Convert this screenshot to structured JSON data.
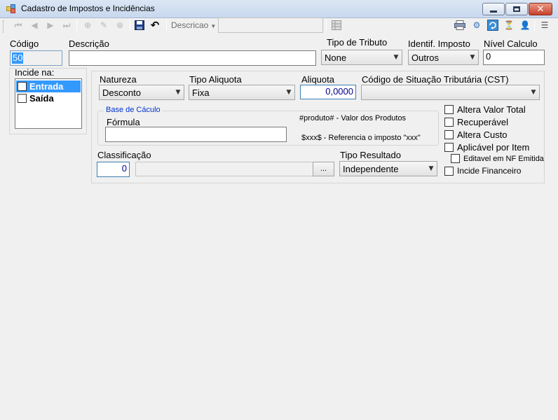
{
  "window": {
    "title": "Cadastro de Impostos e Incidências"
  },
  "toolbar": {
    "search_field_button": "Descricao",
    "search_value": ""
  },
  "form": {
    "codigo": {
      "label": "Código",
      "value": "50"
    },
    "descricao": {
      "label": "Descrição",
      "value": ""
    },
    "tipo_tributo": {
      "label": "Tipo de Tributo",
      "value": "None"
    },
    "identif_imposto": {
      "label": "Identif. Imposto",
      "value": "Outros"
    },
    "nivel_calculo": {
      "label": "Nível Calculo",
      "value": "0"
    },
    "incide_na": {
      "label": "Incide na:",
      "items": [
        {
          "label": "Entrada",
          "checked": false,
          "selected": true
        },
        {
          "label": "Saída",
          "checked": false,
          "selected": false
        }
      ]
    },
    "natureza": {
      "label": "Natureza",
      "value": "Desconto"
    },
    "tipo_aliquota": {
      "label": "Tipo Aliquota",
      "value": "Fixa"
    },
    "aliquota": {
      "label": "Aliquota",
      "value": "0,0000"
    },
    "cst": {
      "label": "Código de Situação Tributária (CST)",
      "value": ""
    },
    "base_calculo": {
      "title": "Base de Cáculo",
      "formula_label": "Fórmula",
      "formula_value": "",
      "hint_produto": "#produto# - Valor dos Produtos",
      "hint_xxx": "$xxx$ - Referencia o imposto \"xxx\""
    },
    "classificacao": {
      "label": "Classificação",
      "value": "0",
      "description": "",
      "browse_label": "..."
    },
    "tipo_resultado": {
      "label": "Tipo Resultado",
      "value": "Independente"
    },
    "options": {
      "altera_valor_total": "Altera Valor Total",
      "recuperavel": "Recuperável",
      "altera_custo": "Altera Custo",
      "aplicavel_por_item": "Aplicável por Item",
      "editavel_nf_emitida": "Editavel em NF Emitida",
      "incide_financeiro": "Incide Financeiro"
    }
  },
  "colors": {
    "selection": "#3399ff",
    "group_title": "#0033cc",
    "numeric_text": "#00008b",
    "background": "#f0f0f0"
  }
}
